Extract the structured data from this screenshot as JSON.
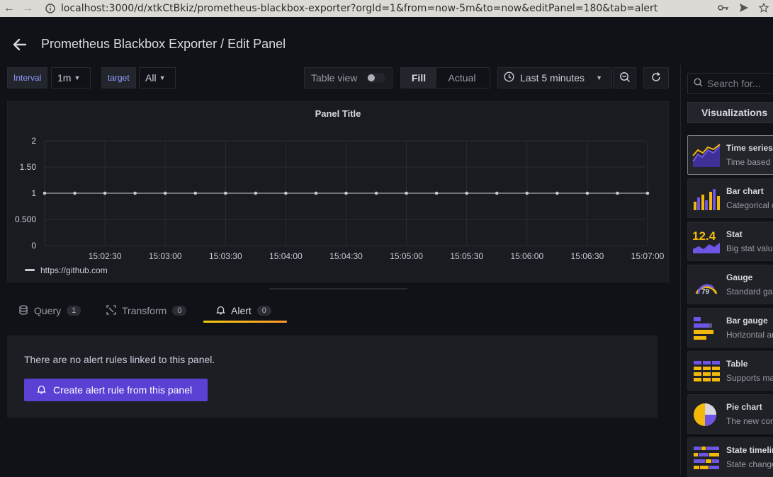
{
  "browser": {
    "url": "localhost:3000/d/xtkCtBkiz/prometheus-blackbox-exporter?orgId=1&from=now-5m&to=now&editPanel=180&tab=alert"
  },
  "header": {
    "title": "Prometheus Blackbox Exporter / Edit Panel"
  },
  "variables": {
    "interval_label": "Interval",
    "interval_value": "1m",
    "target_label": "target",
    "target_value": "All"
  },
  "toolbar": {
    "table_view_label": "Table view",
    "fill_label": "Fill",
    "actual_label": "Actual",
    "time_range": "Last 5 minutes"
  },
  "panel": {
    "title": "Panel Title"
  },
  "chart_data": {
    "type": "line",
    "title": "Panel Title",
    "x": [
      "15:02:00",
      "15:02:15",
      "15:02:30",
      "15:02:45",
      "15:03:00",
      "15:03:15",
      "15:03:30",
      "15:03:45",
      "15:04:00",
      "15:04:15",
      "15:04:30",
      "15:04:45",
      "15:05:00",
      "15:05:15",
      "15:05:30",
      "15:05:45",
      "15:06:00",
      "15:06:15",
      "15:06:30",
      "15:06:45",
      "15:07:00"
    ],
    "x_ticks": [
      "15:02:30",
      "15:03:00",
      "15:03:30",
      "15:04:00",
      "15:04:30",
      "15:05:00",
      "15:05:30",
      "15:06:00",
      "15:06:30",
      "15:07:00"
    ],
    "y_ticks": [
      "0",
      "0.500",
      "1",
      "1.50",
      "2"
    ],
    "ylim": [
      0,
      2
    ],
    "series": [
      {
        "name": "https://github.com",
        "values": [
          1,
          1,
          1,
          1,
          1,
          1,
          1,
          1,
          1,
          1,
          1,
          1,
          1,
          1,
          1,
          1,
          1,
          1,
          1,
          1,
          1
        ],
        "color": "#c8c9d2"
      }
    ],
    "grid": true,
    "legend": "bottom-left"
  },
  "editor_tabs": [
    {
      "label": "Query",
      "count": "1"
    },
    {
      "label": "Transform",
      "count": "0"
    },
    {
      "label": "Alert",
      "count": "0"
    }
  ],
  "alert": {
    "message": "There are no alert rules linked to this panel.",
    "button_label": "Create alert rule from this panel"
  },
  "sidebar": {
    "search_placeholder": "Search for...",
    "visualizations_label": "Visualizations",
    "items": [
      {
        "name": "Time series",
        "desc": "Time based line, area and bar charts"
      },
      {
        "name": "Bar chart",
        "desc": "Categorical charts with group support"
      },
      {
        "name": "Stat",
        "desc": "Big stat values & sparklines"
      },
      {
        "name": "Gauge",
        "desc": "Standard gauge visualization"
      },
      {
        "name": "Bar gauge",
        "desc": "Horizontal and vertical gauges"
      },
      {
        "name": "Table",
        "desc": "Supports many column styles"
      },
      {
        "name": "Pie chart",
        "desc": "The new core pie chart visualization"
      },
      {
        "name": "State timeline",
        "desc": "State changes and durations"
      }
    ]
  },
  "colors": {
    "accent_primary": "#5b40d4",
    "tab_underline": "#ff9830",
    "variable_label": "#8e9bff"
  }
}
